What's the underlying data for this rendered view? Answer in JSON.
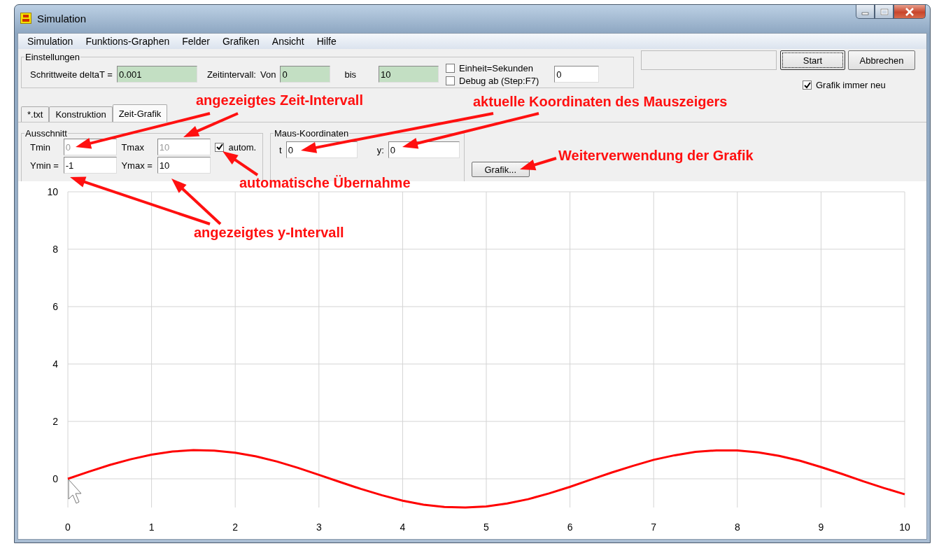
{
  "window": {
    "title": "Simulation"
  },
  "menu": [
    "Simulation",
    "Funktions-Graphen",
    "Felder",
    "Grafiken",
    "Ansicht",
    "Hilfe"
  ],
  "settings": {
    "legend": "Einstellungen",
    "step_label": "Schrittweite deltaT =",
    "step": "0.001",
    "interval_label": "Zeitintervall:",
    "from_label": "Von",
    "from": "0",
    "to_label": "bis",
    "to": "10",
    "checkboxes": [
      {
        "label": "Einheit=Sekunden",
        "checked": false
      },
      {
        "label": "Debug ab (Step:F7)",
        "checked": false
      }
    ],
    "debug_step": "0"
  },
  "actions": {
    "buttons": [
      {
        "label": "Start",
        "focused": true
      },
      {
        "label": "Abbrechen",
        "focused": false
      }
    ],
    "redraw": {
      "label": "Grafik immer neu",
      "checked": true
    }
  },
  "tabs": [
    {
      "label": "*.txt",
      "selected": false
    },
    {
      "label": "Konstruktion",
      "selected": false
    },
    {
      "label": "Zeit-Grafik",
      "selected": true
    }
  ],
  "range": {
    "legend": "Ausschnitt",
    "fields": [
      {
        "label": "Tmin",
        "value": "0",
        "disabled": true
      },
      {
        "label": "Tmax",
        "value": "10",
        "disabled": true
      },
      {
        "label": "Ymin =",
        "value": "-1",
        "disabled": false
      },
      {
        "label": "Ymax =",
        "value": "10",
        "disabled": false
      }
    ],
    "auto": {
      "label": "autom.",
      "checked": true
    }
  },
  "mouse": {
    "legend": "Maus-Koordinaten",
    "fields": [
      {
        "label": "t",
        "value": "0"
      },
      {
        "label": "y:",
        "value": "0"
      }
    ]
  },
  "export_button": "Grafik...",
  "chart": {
    "chart_data": {
      "type": "line",
      "x": [
        0,
        0.25,
        0.5,
        0.75,
        1,
        1.25,
        1.5,
        1.75,
        2,
        2.25,
        2.5,
        2.75,
        3,
        3.25,
        3.5,
        3.75,
        4,
        4.25,
        4.5,
        4.75,
        5,
        5.25,
        5.5,
        5.75,
        6,
        6.25,
        6.5,
        6.75,
        7,
        7.25,
        7.5,
        7.75,
        8,
        8.25,
        8.5,
        8.75,
        9,
        9.25,
        9.5,
        9.75,
        10
      ],
      "series": [
        {
          "color": "#ff0000",
          "values": [
            0,
            0.25,
            0.48,
            0.68,
            0.84,
            0.95,
            1,
            0.98,
            0.91,
            0.78,
            0.6,
            0.38,
            0.14,
            -0.11,
            -0.35,
            -0.57,
            -0.76,
            -0.9,
            -0.98,
            -1,
            -0.96,
            -0.86,
            -0.71,
            -0.51,
            -0.28,
            -0.03,
            0.22,
            0.45,
            0.66,
            0.82,
            0.94,
            0.99,
            0.99,
            0.92,
            0.8,
            0.63,
            0.41,
            0.17,
            -0.08,
            -0.32,
            -0.54
          ]
        }
      ],
      "xlim": [
        0,
        10
      ],
      "ylim": [
        -1,
        10
      ],
      "grid": true,
      "xticks": [
        0,
        1,
        2,
        3,
        4,
        5,
        6,
        7,
        8,
        9,
        10
      ],
      "yticks": [
        0,
        2,
        4,
        6,
        8,
        10
      ]
    }
  },
  "annotations": [
    {
      "text": "angezeigtes Zeit-Intervall"
    },
    {
      "text": "aktuelle Koordinaten des Mauszeigers"
    },
    {
      "text": "automatische Übernahme"
    },
    {
      "text": "Weiterverwendung der Grafik"
    },
    {
      "text": "angezeigtes y-Intervall"
    }
  ]
}
